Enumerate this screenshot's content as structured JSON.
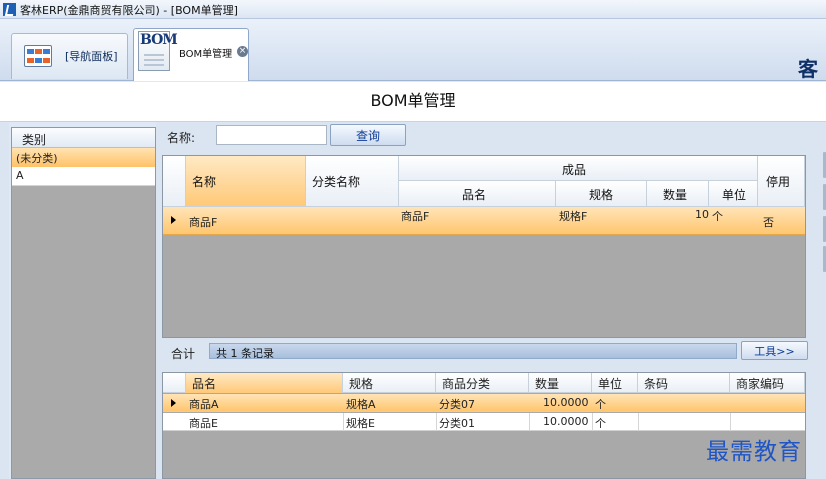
{
  "window": {
    "title": "客林ERP(金鼎商贸有限公司) - [BOM单管理]"
  },
  "tabs": {
    "nav_label": "[导航面板]",
    "bom_icon_text": "BOM",
    "bom_label": "BOM单管理",
    "close_glyph": "×"
  },
  "corner_text": "客",
  "page": {
    "title": "BOM单管理"
  },
  "category": {
    "header": "类别",
    "items": [
      {
        "label": "(未分类)",
        "selected": true
      },
      {
        "label": "A",
        "selected": false
      }
    ]
  },
  "search": {
    "label": "名称:",
    "value": "",
    "button_label": "查询"
  },
  "bom_grid": {
    "headers": {
      "name": "名称",
      "category_name": "分类名称",
      "group_product": "成品",
      "product_name": "品名",
      "spec": "规格",
      "qty": "数量",
      "unit": "单位",
      "disabled": "停用"
    },
    "rows": [
      {
        "name": "商品F",
        "category_name": "",
        "product_name": "商品F",
        "spec": "规格F",
        "qty": "10",
        "unit": "个",
        "disabled": "否"
      }
    ]
  },
  "summary": {
    "label": "合计",
    "text": "共 1 条记录",
    "tools_label": "工具>>"
  },
  "detail_grid": {
    "headers": [
      "品名",
      "规格",
      "商品分类",
      "数量",
      "单位",
      "条码",
      "商家编码"
    ],
    "rows": [
      {
        "name": "商品A",
        "spec": "规格A",
        "category": "分类07",
        "qty": "10.0000",
        "unit": "个",
        "barcode": "",
        "merchant_code": ""
      },
      {
        "name": "商品E",
        "spec": "规格E",
        "category": "分类01",
        "qty": "10.0000",
        "unit": "个",
        "barcode": "",
        "merchant_code": ""
      }
    ]
  },
  "watermark": "最需教育",
  "colors": {
    "selection": "#ffc66e",
    "grid_empty": "#a9a9a9",
    "accent_blue": "#0e3d96",
    "watermark": "#1f55c4"
  }
}
